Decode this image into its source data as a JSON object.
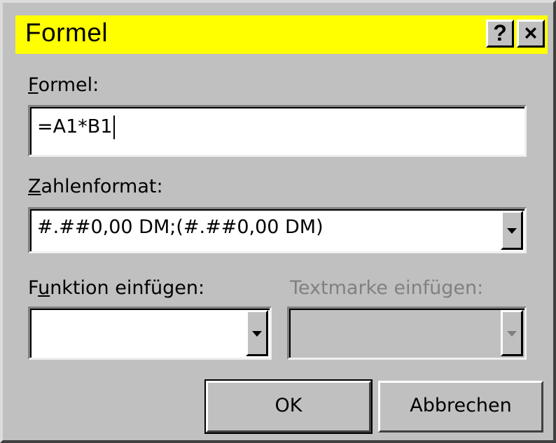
{
  "dialog": {
    "title": "Formel",
    "help_button": "?",
    "close_button": "×"
  },
  "formula": {
    "label_accel": "F",
    "label_rest": "ormel:",
    "value": "=A1*B1"
  },
  "number_format": {
    "label_accel": "Z",
    "label_rest": "ahlenformat:",
    "value": "#.##0,00 DM;(#.##0,00 DM)"
  },
  "insert_function": {
    "label_pre": "F",
    "label_accel": "u",
    "label_rest": "nktion einfügen:",
    "value": ""
  },
  "insert_bookmark": {
    "label": "Textmarke einfügen:",
    "value": "",
    "enabled": false
  },
  "buttons": {
    "ok": "OK",
    "cancel": "Abbrechen"
  },
  "icons": {
    "help": "help-icon",
    "close": "close-icon",
    "dropdown": "chevron-down-icon"
  },
  "colors": {
    "titlebar": "#ffff00",
    "face": "#c0c0c0",
    "disabled_text": "#808080"
  }
}
